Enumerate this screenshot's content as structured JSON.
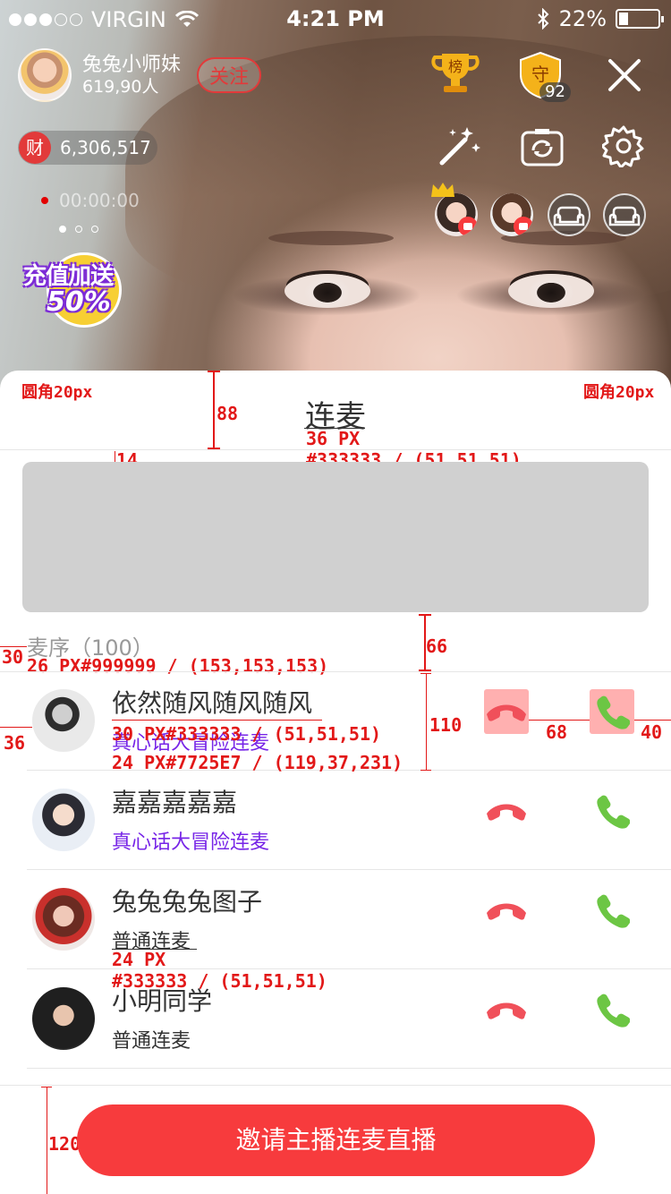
{
  "status_bar": {
    "carrier": "VIRGIN",
    "time": "4:21 PM",
    "battery": "22%"
  },
  "host": {
    "name": "兔兔小师妹",
    "followers": "619,90人",
    "follow_label": "关注"
  },
  "wealth": {
    "badge": "财",
    "value": "6,306,517"
  },
  "record_time": "00:00:00",
  "promo": {
    "line1": "充值加送",
    "line2": "50%"
  },
  "top_icons": {
    "rank_label": "榜",
    "guard_label": "守",
    "guard_count": "92"
  },
  "panel": {
    "title": "连麦",
    "queue_label": "麦序（100）",
    "invite_button": "邀请主播连麦直播"
  },
  "requests": [
    {
      "name": "依然随风随风随风",
      "mode": "真心话大冒险连麦",
      "mode_color": "#7725E7"
    },
    {
      "name": "嘉嘉嘉嘉嘉",
      "mode": "真心话大冒险连麦",
      "mode_color": "#7725E7"
    },
    {
      "name": "兔兔兔兔图子",
      "mode": "普通连麦",
      "mode_color": "#333333"
    },
    {
      "name": "小明同学",
      "mode": "普通连麦",
      "mode_color": "#333333"
    }
  ],
  "annotations": {
    "radius_left": "圆角20px",
    "radius_right": "圆角20px",
    "h88": "88",
    "title_size": "36 PX",
    "title_color": "#333333 / (51,51,51)",
    "gap14": "14",
    "h66": "66",
    "pad30": "30",
    "queue_spec": "26 PX#999999 / (153,153,153)",
    "pad36": "36",
    "h110": "110",
    "gap68": "68",
    "pad40": "40",
    "name_spec": "30 PX#333333 / (51,51,51)",
    "mode_spec": "24 PX#7725E7 / (119,37,231)",
    "normal_size": "24 PX",
    "normal_color": "#333333 / (51,51,51)",
    "h120": "120"
  },
  "colors": {
    "accent_red": "#f73b3d",
    "hangup": "#f0505a",
    "accept": "#6cc644",
    "purple": "#7725E7"
  }
}
